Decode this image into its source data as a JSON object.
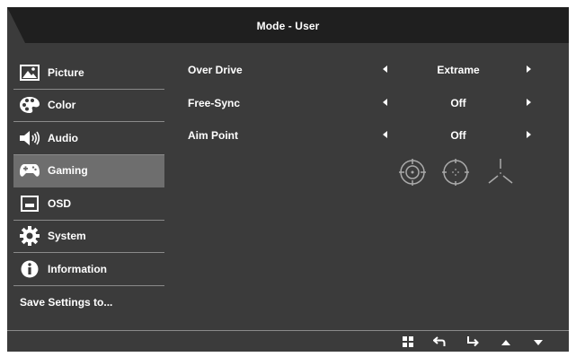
{
  "header": {
    "title": "Mode - User"
  },
  "sidebar": {
    "items": [
      {
        "label": "Picture",
        "icon": "picture-icon"
      },
      {
        "label": "Color",
        "icon": "palette-icon"
      },
      {
        "label": "Audio",
        "icon": "speaker-icon"
      },
      {
        "label": "Gaming",
        "icon": "gamepad-icon",
        "active": true
      },
      {
        "label": "OSD",
        "icon": "osd-icon"
      },
      {
        "label": "System",
        "icon": "gear-icon"
      },
      {
        "label": "Information",
        "icon": "info-icon"
      }
    ],
    "save": {
      "label": "Save Settings to..."
    }
  },
  "settings": [
    {
      "label": "Over Drive",
      "value": "Extrame"
    },
    {
      "label": "Free-Sync",
      "value": "Off"
    },
    {
      "label": "Aim Point",
      "value": "Off"
    }
  ],
  "aim_point_options": [
    "crosshair-circle-icon",
    "crosshair-dotted-circle-icon",
    "crosshair-tri-lines-icon"
  ],
  "nav_icons": [
    "menu-grid-icon",
    "back-icon",
    "enter-icon",
    "up-arrow-icon",
    "down-arrow-icon"
  ],
  "colors": {
    "background": "#3b3b3b",
    "titlebar": "#1f1f1f",
    "active_item": "#6e6e6e",
    "divider": "#8a8a8a",
    "text": "#ffffff"
  }
}
